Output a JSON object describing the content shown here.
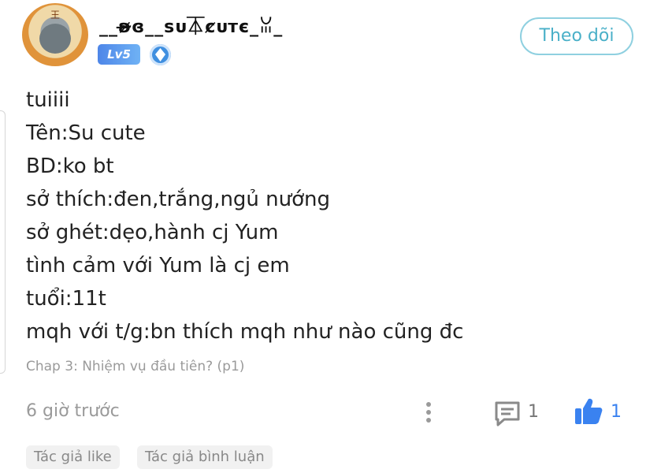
{
  "author": {
    "username": "__ʚ̴̶̷ɞ__ꜱᴜ⏄ȼᴜᴛє_ꈍ_",
    "level_badge": "Lv5",
    "follow_label": "Theo dõi"
  },
  "post": {
    "lines": [
      "tuiiii",
      "Tên:Su cute",
      "BD:ko bt",
      "sở thích:đen,trắng,ngủ nướng",
      "sở ghét:dẹo,hành cj Yum",
      "tình cảm với Yum là cj em",
      "tuổi:11t",
      "mqh với t/g:bn thích mqh như nào cũng đc"
    ],
    "chapter": "Chap 3: Nhiệm vụ đầu tiên? (p1)"
  },
  "footer": {
    "time": "6 giờ trước",
    "comment_count": "1",
    "like_count": "1"
  },
  "tags": [
    "Tác giả like",
    "Tác giả bình luận"
  ],
  "icons": [
    "avatar-image",
    "rank-icon",
    "more-icon",
    "comment-icon",
    "like-icon"
  ],
  "colors": {
    "accent": "#4ab0c8",
    "like_blue": "#3a82f0",
    "level_badge": "#4e86e8"
  }
}
